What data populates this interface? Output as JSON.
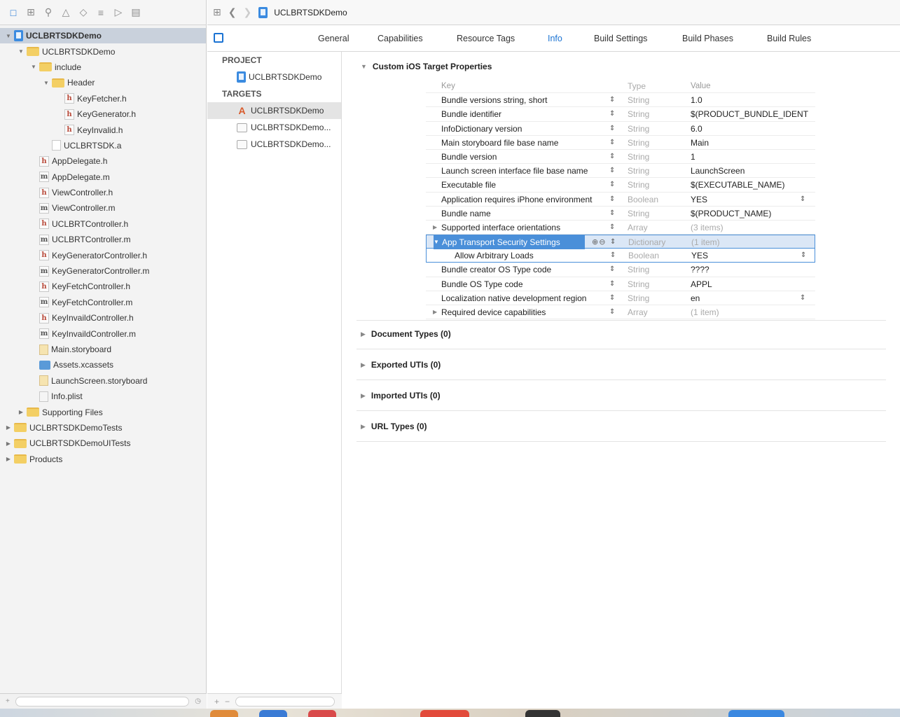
{
  "navigator": {
    "toolbar_icons": [
      "folder-icon",
      "hierarchy-icon",
      "search-icon",
      "warning-icon",
      "diamond-icon",
      "breakpoints-icon",
      "tag-icon",
      "report-icon"
    ],
    "tree": [
      {
        "label": "UCLBRTSDKDemo",
        "indent": 0,
        "disclosure": "▼",
        "icon": "project",
        "selected": true,
        "bold": true
      },
      {
        "label": "UCLBRTSDKDemo",
        "indent": 1,
        "disclosure": "▼",
        "icon": "folder"
      },
      {
        "label": "include",
        "indent": 2,
        "disclosure": "▼",
        "icon": "folder"
      },
      {
        "label": "Header",
        "indent": 3,
        "disclosure": "▼",
        "icon": "folder"
      },
      {
        "label": "KeyFetcher.h",
        "indent": 4,
        "icon": "h"
      },
      {
        "label": "KeyGenerator.h",
        "indent": 4,
        "icon": "h"
      },
      {
        "label": "KeyInvalid.h",
        "indent": 4,
        "icon": "h"
      },
      {
        "label": "UCLBRTSDK.a",
        "indent": 3,
        "icon": "lib"
      },
      {
        "label": "AppDelegate.h",
        "indent": 2,
        "icon": "h"
      },
      {
        "label": "AppDelegate.m",
        "indent": 2,
        "icon": "m"
      },
      {
        "label": "ViewController.h",
        "indent": 2,
        "icon": "h"
      },
      {
        "label": "ViewController.m",
        "indent": 2,
        "icon": "m"
      },
      {
        "label": "UCLBRTController.h",
        "indent": 2,
        "icon": "h"
      },
      {
        "label": "UCLBRTController.m",
        "indent": 2,
        "icon": "m"
      },
      {
        "label": "KeyGeneratorController.h",
        "indent": 2,
        "icon": "h"
      },
      {
        "label": "KeyGeneratorController.m",
        "indent": 2,
        "icon": "m"
      },
      {
        "label": "KeyFetchController.h",
        "indent": 2,
        "icon": "h"
      },
      {
        "label": "KeyFetchController.m",
        "indent": 2,
        "icon": "m"
      },
      {
        "label": "KeyInvaildController.h",
        "indent": 2,
        "icon": "h"
      },
      {
        "label": "KeyInvaildController.m",
        "indent": 2,
        "icon": "m"
      },
      {
        "label": "Main.storyboard",
        "indent": 2,
        "icon": "storyboard"
      },
      {
        "label": "Assets.xcassets",
        "indent": 2,
        "icon": "assets"
      },
      {
        "label": "LaunchScreen.storyboard",
        "indent": 2,
        "icon": "storyboard"
      },
      {
        "label": "Info.plist",
        "indent": 2,
        "icon": "plist"
      },
      {
        "label": "Supporting Files",
        "indent": 1,
        "disclosure": "▶",
        "icon": "folder"
      },
      {
        "label": "UCLBRTSDKDemoTests",
        "indent": 0,
        "disclosure": "▶",
        "icon": "folder"
      },
      {
        "label": "UCLBRTSDKDemoUITests",
        "indent": 0,
        "disclosure": "▶",
        "icon": "folder"
      },
      {
        "label": "Products",
        "indent": 0,
        "disclosure": "▶",
        "icon": "folder"
      }
    ]
  },
  "jumpbar": {
    "crumb": "UCLBRTSDKDemo"
  },
  "tabs": [
    {
      "label": "General",
      "active": false
    },
    {
      "label": "Capabilities",
      "active": false
    },
    {
      "label": "Resource Tags",
      "active": false
    },
    {
      "label": "Info",
      "active": true
    },
    {
      "label": "Build Settings",
      "active": false
    },
    {
      "label": "Build Phases",
      "active": false
    },
    {
      "label": "Build Rules",
      "active": false
    }
  ],
  "targets_pane": {
    "project_header": "PROJECT",
    "project_item": "UCLBRTSDKDemo",
    "targets_header": "TARGETS",
    "targets": [
      {
        "label": "UCLBRTSDKDemo",
        "icon": "app",
        "selected": true
      },
      {
        "label": "UCLBRTSDKDemo...",
        "icon": "bundle"
      },
      {
        "label": "UCLBRTSDKDemo...",
        "icon": "bundle"
      }
    ]
  },
  "info": {
    "custom_section_title": "Custom iOS Target Properties",
    "columns": {
      "key": "Key",
      "type": "Type",
      "value": "Value"
    },
    "rows": [
      {
        "key": "Bundle versions string, short",
        "type": "String",
        "value": "1.0"
      },
      {
        "key": "Bundle identifier",
        "type": "String",
        "value": "$(PRODUCT_BUNDLE_IDENT"
      },
      {
        "key": "InfoDictionary version",
        "type": "String",
        "value": "6.0"
      },
      {
        "key": "Main storyboard file base name",
        "type": "String",
        "value": "Main"
      },
      {
        "key": "Bundle version",
        "type": "String",
        "value": "1"
      },
      {
        "key": "Launch screen interface file base name",
        "type": "String",
        "value": "LaunchScreen"
      },
      {
        "key": "Executable file",
        "type": "String",
        "value": "$(EXECUTABLE_NAME)"
      },
      {
        "key": "Application requires iPhone environment",
        "type": "Boolean",
        "value": "YES",
        "value_stepper": true
      },
      {
        "key": "Bundle name",
        "type": "String",
        "value": "$(PRODUCT_NAME)"
      },
      {
        "key": "Supported interface orientations",
        "type": "Array",
        "value": "(3 items)",
        "collapsed": true,
        "dim": true
      },
      {
        "key": "App Transport Security Settings",
        "type": "Dictionary",
        "value": "(1 item)",
        "expanded": true,
        "selected": true,
        "dim": true
      },
      {
        "key": "Allow Arbitrary Loads",
        "type": "Boolean",
        "value": "YES",
        "child": true,
        "value_stepper": true
      },
      {
        "key": "Bundle creator OS Type code",
        "type": "String",
        "value": "????"
      },
      {
        "key": "Bundle OS Type code",
        "type": "String",
        "value": "APPL"
      },
      {
        "key": "Localization native development region",
        "type": "String",
        "value": "en",
        "value_stepper": true
      },
      {
        "key": "Required device capabilities",
        "type": "Array",
        "value": "(1 item)",
        "collapsed": true,
        "dim": true
      }
    ],
    "other_sections": [
      "Document Types (0)",
      "Exported UTIs (0)",
      "Imported UTIs (0)",
      "URL Types (0)"
    ]
  },
  "colors": {
    "accent": "#1b73d3",
    "selection": "#4a8fd9",
    "navigator_bg": "#f3f3f3"
  }
}
